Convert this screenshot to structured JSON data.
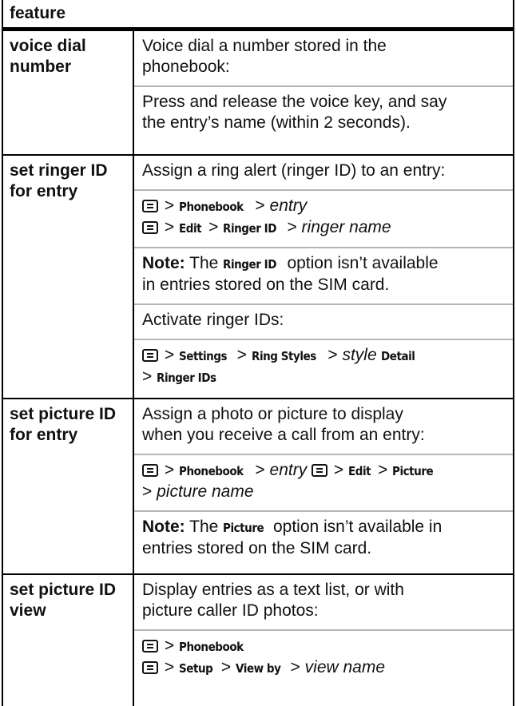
{
  "table": {
    "header": "feature",
    "rows": [
      {
        "feature": [
          "voice dial",
          "number"
        ],
        "blocks": [
          {
            "text": [
              "Voice dial a number stored in the",
              "phonebook:"
            ]
          },
          {
            "text": [
              "Press and release the voice key, and say",
              "the entry’s name (within 2 seconds)."
            ]
          }
        ]
      },
      {
        "feature": [
          "set ringer ID",
          "for entry"
        ],
        "blocks": [
          {
            "text": [
              "Assign a ring alert (ringer ID) to an entry:"
            ]
          },
          {
            "path1": {
              "sep": ">",
              "kw": "Phonebook",
              "tail": "entry"
            },
            "path2": {
              "sep": ">",
              "kw1": "Edit",
              "kw2": "Ringer ID",
              "tail": "ringer name"
            }
          },
          {
            "note_label": "Note:",
            "note_pre": "The",
            "note_kw": "Ringer ID",
            "note_post": "option isn’t available",
            "note_line2": "in entries stored on the SIM card."
          },
          {
            "text": [
              "Activate ringer IDs:"
            ]
          },
          {
            "path1": {
              "kw1": "Settings",
              "kw2": "Ring Styles",
              "tail": "style",
              "kw3": "Detail"
            },
            "path2": {
              "kw": "Ringer IDs"
            }
          }
        ]
      },
      {
        "feature": [
          "set picture ID",
          "for entry"
        ],
        "blocks": [
          {
            "text": [
              "Assign a photo or picture to display",
              "when you receive a call from an entry:"
            ]
          },
          {
            "path1": {
              "kw1": "Phonebook",
              "tail": "entry",
              "kw2": "Edit",
              "kw3": "Picture"
            },
            "path2": {
              "tail": "picture name"
            }
          },
          {
            "note_label": "Note:",
            "note_pre": "The",
            "note_kw": "Picture",
            "note_post": "option isn’t available in",
            "note_line2": "entries stored on the SIM card."
          }
        ]
      },
      {
        "feature": [
          "set picture ID",
          "view"
        ],
        "blocks": [
          {
            "text": [
              "Display entries as a text list, or with",
              "picture caller ID photos:"
            ]
          },
          {
            "path1": {
              "kw": "Phonebook"
            },
            "path2": {
              "kw1": "Setup",
              "kw2": "View by",
              "tail": "view name"
            }
          }
        ]
      }
    ]
  }
}
